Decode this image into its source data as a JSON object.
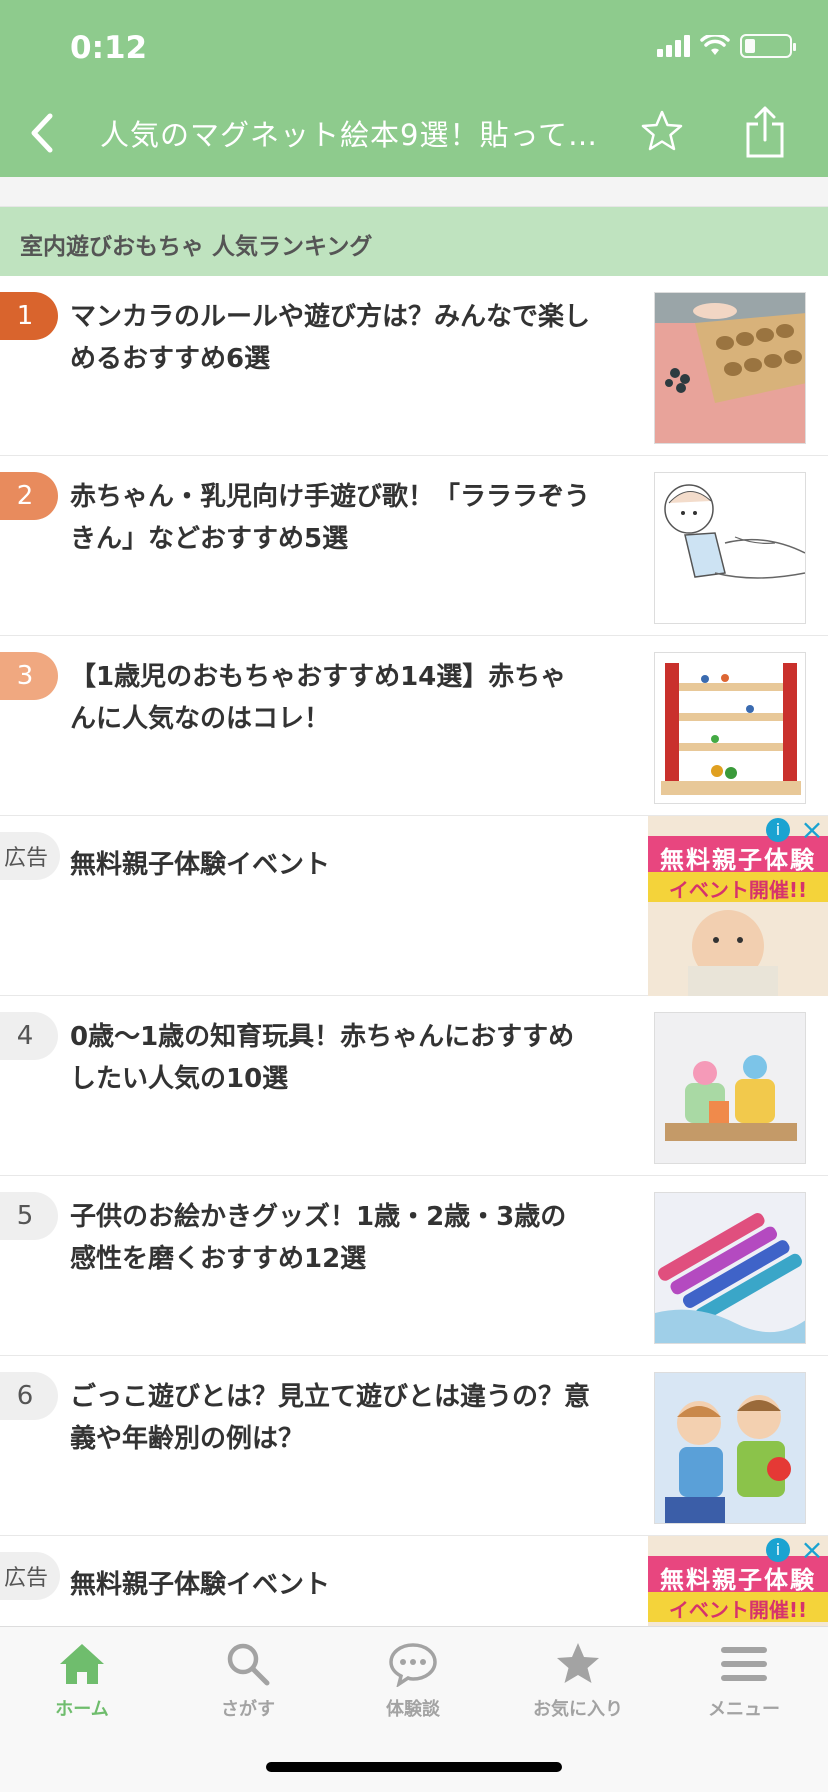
{
  "status": {
    "time": "0:12"
  },
  "nav": {
    "title": "人気のマグネット絵本9選！貼って…"
  },
  "section": {
    "title": "室内遊びおもちゃ 人気ランキング"
  },
  "rows": [
    {
      "badge": "1",
      "text": "マンカラのルールや遊び方は？みんなで楽しめるおすすめ6選",
      "badge_color": "#d9642d",
      "thumb": "mancala-board-photo"
    },
    {
      "badge": "2",
      "text": "赤ちゃん・乳児向け手遊び歌！「ラララぞうきん」などおすすめ5選",
      "badge_color": "#e88b5d",
      "thumb": "baby-illustration"
    },
    {
      "badge": "3",
      "text": "【1歳児のおもちゃおすすめ14選】赤ちゃんに人気なのはコレ！",
      "badge_color": "#f0a880",
      "thumb": "wooden-slope-toy-photo"
    },
    {
      "badge": "広告",
      "text": "無料親子体験イベント",
      "ad": true,
      "ad_banner_top": "無料親子体験",
      "ad_banner_bottom": "イベント開催!!"
    },
    {
      "badge": "4",
      "text": "0歳〜1歳の知育玩具！赤ちゃんにおすすめしたい人気の10選",
      "thumb": "educational-toy-photo"
    },
    {
      "badge": "5",
      "text": "子供のお絵かきグッズ！1歳・2歳・3歳の感性を磨くおすすめ12選",
      "thumb": "crayons-photo"
    },
    {
      "badge": "6",
      "text": "ごっこ遊びとは？見立て遊びとは違うの？意義や年齢別の例は？",
      "thumb": "kids-playing-photo"
    },
    {
      "badge": "広告",
      "text": "無料親子体験イベント",
      "ad": true,
      "ad_banner_top": "無料親子体験",
      "ad_banner_bottom": "イベント開催!!"
    }
  ],
  "tabs": [
    {
      "label": "ホーム",
      "icon": "home-icon",
      "active": true
    },
    {
      "label": "さがす",
      "icon": "search-icon"
    },
    {
      "label": "体験談",
      "icon": "chat-bubble-icon"
    },
    {
      "label": "お気に入り",
      "icon": "star-icon"
    },
    {
      "label": "メニュー",
      "icon": "menu-icon"
    }
  ],
  "colors": {
    "header": "#8ecb8d",
    "section": "#bfe3bf",
    "active_tab": "#6fbd6d"
  }
}
